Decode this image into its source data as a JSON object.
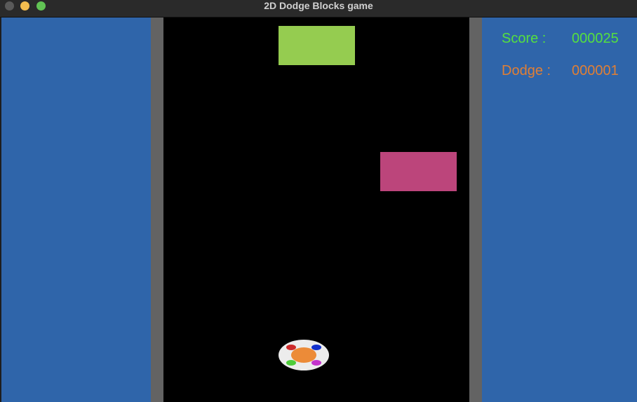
{
  "window": {
    "title": "2D Dodge Blocks game"
  },
  "hud": {
    "score_label": "Score :",
    "score_value": "000025",
    "dodge_label": "Dodge :",
    "dodge_value": "000001"
  },
  "colors": {
    "side_panel": "#2f65aa",
    "wall": "#636363",
    "road": "#000000",
    "score_text": "#55e03f",
    "dodge_text": "#e07f35",
    "block_green": "#95cc50",
    "block_pink": "#bc457b",
    "player_base": "#ececec",
    "player_core": "#ec8b38",
    "light_red": "#cc2a2a",
    "light_blue": "#1230cc",
    "light_green": "#4ecc3a",
    "light_purple": "#c433cc"
  },
  "blocks": [
    {
      "name": "falling-block-green",
      "color": "#95cc50"
    },
    {
      "name": "falling-block-pink",
      "color": "#bc457b"
    }
  ],
  "player": {
    "name": "player-car"
  }
}
